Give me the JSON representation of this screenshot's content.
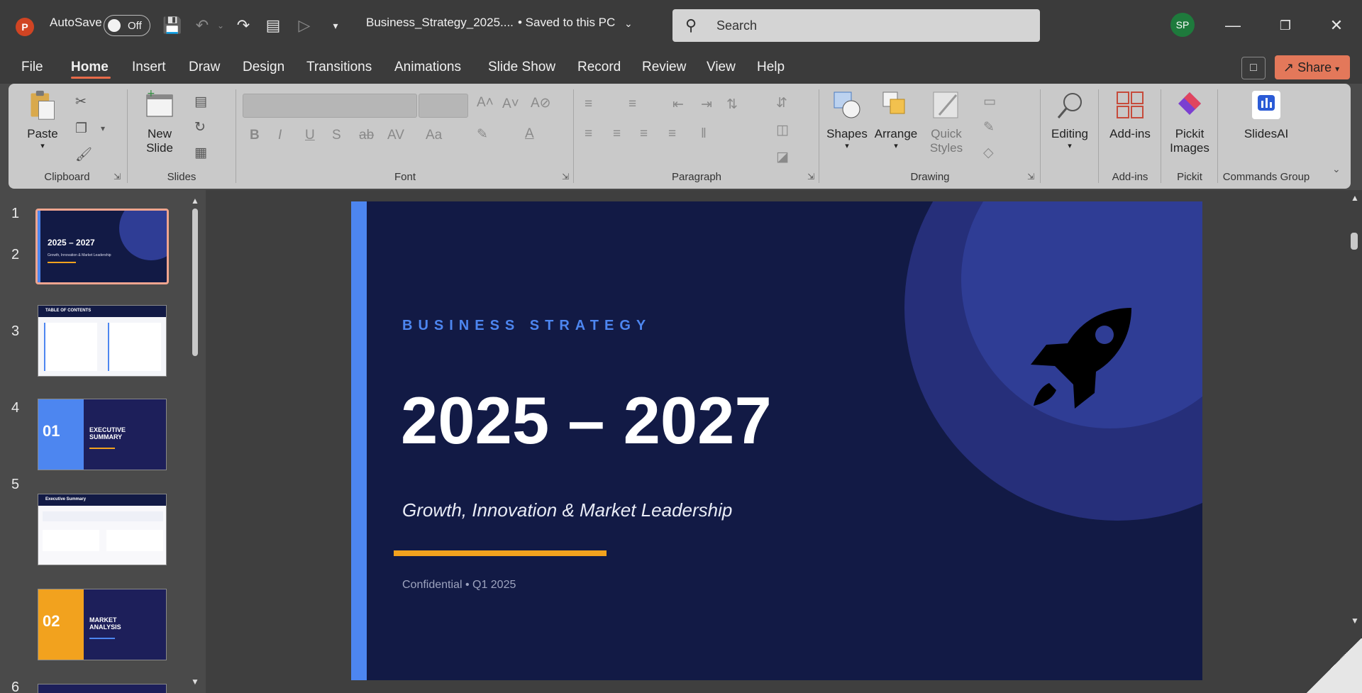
{
  "titlebar": {
    "app_logo": "P",
    "autosave_label": "AutoSave",
    "autosave_state": "Off",
    "filename": "Business_Strategy_2025....",
    "save_status": "• Saved to this PC",
    "search_placeholder": "Search",
    "avatar_initials": "SP"
  },
  "tabs": [
    "File",
    "Home",
    "Insert",
    "Draw",
    "Design",
    "Transitions",
    "Animations",
    "Slide Show",
    "Record",
    "Review",
    "View",
    "Help"
  ],
  "active_tab": "Home",
  "share_label": "Share",
  "ribbon": {
    "paste": "Paste",
    "new_slide_1": "New",
    "new_slide_2": "Slide",
    "shapes": "Shapes",
    "arrange": "Arrange",
    "quick_styles_1": "Quick",
    "quick_styles_2": "Styles",
    "editing": "Editing",
    "add_ins": "Add-ins",
    "pickit_1": "Pickit",
    "pickit_2": "Images",
    "slidesai": "SlidesAI",
    "groups": {
      "clipboard": "Clipboard",
      "slides": "Slides",
      "font": "Font",
      "paragraph": "Paragraph",
      "drawing": "Drawing",
      "add_ins": "Add-ins",
      "pickit": "Pickit",
      "commands": "Commands Group"
    }
  },
  "thumbnails": [
    {
      "num": "1",
      "title": "2025 – 2027",
      "subtitle": "Growth, Innovation & Market Leadership"
    },
    {
      "num": "2",
      "title": "TABLE OF CONTENTS"
    },
    {
      "num": "3",
      "badge": "01",
      "title": "EXECUTIVE SUMMARY"
    },
    {
      "num": "4",
      "title": "Executive Summary"
    },
    {
      "num": "5",
      "badge": "02",
      "title": "MARKET ANALYSIS"
    },
    {
      "num": "6"
    }
  ],
  "slide": {
    "kicker": "BUSINESS STRATEGY",
    "years": "2025 – 2027",
    "tagline": "Growth, Innovation & Market Leadership",
    "footer": "Confidential  •  Q1 2025"
  },
  "colors": {
    "slide_bg": "#121a45",
    "accent_blue": "#4d86f0",
    "accent_orange": "#f2a21e",
    "share_btn": "#e3785a"
  }
}
